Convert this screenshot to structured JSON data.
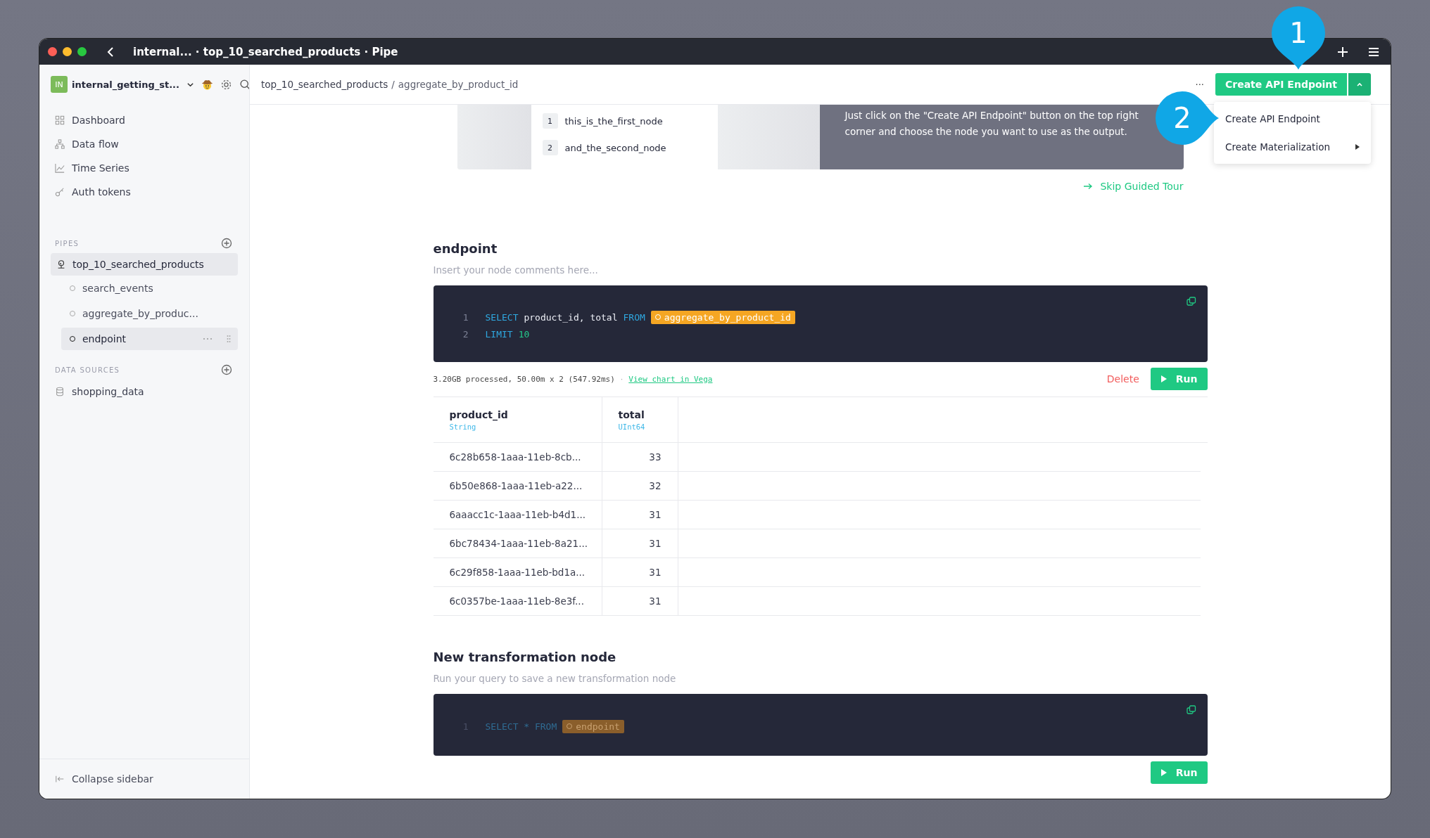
{
  "window": {
    "title": "internal... · top_10_searched_products · Pipe"
  },
  "workspace": {
    "initials": "IN",
    "name": "internal_getting_st..."
  },
  "nav": [
    {
      "label": "Dashboard"
    },
    {
      "label": "Data flow"
    },
    {
      "label": "Time Series"
    },
    {
      "label": "Auth tokens"
    }
  ],
  "pipes": {
    "heading": "PIPES",
    "items": [
      {
        "label": "top_10_searched_products",
        "selected": true,
        "children": [
          {
            "label": "search_events",
            "selected": false
          },
          {
            "label": "aggregate_by_produc...",
            "selected": false
          },
          {
            "label": "endpoint",
            "selected": true
          }
        ]
      }
    ]
  },
  "data_sources": {
    "heading": "DATA SOURCES",
    "items": [
      {
        "label": "shopping_data"
      }
    ]
  },
  "collapse_sidebar": "Collapse sidebar",
  "breadcrumb": {
    "parent": "top_10_searched_products",
    "separator": "/",
    "current": "aggregate_by_product_id"
  },
  "more": "···",
  "create_button": "Create API Endpoint",
  "menu": [
    {
      "label": "Create API Endpoint",
      "submenu": false
    },
    {
      "label": "Create Materialization",
      "submenu": true
    }
  ],
  "callouts": [
    "1",
    "2"
  ],
  "tour": {
    "nodes": [
      {
        "number": "1",
        "name": "this_is_the_first_node"
      },
      {
        "number": "2",
        "name": "and_the_second_node"
      }
    ],
    "text": "Just click on the \"Create API Endpoint\" button on the top right corner and choose the node you want to use as the output.",
    "skip": "Skip Guided Tour"
  },
  "nodes": [
    {
      "title": "endpoint",
      "subtitle": "Insert your node comments here...",
      "dimmed": false,
      "code": [
        {
          "number": "1",
          "tokens": [
            {
              "kind": "keyword",
              "text": "SELECT"
            },
            {
              "kind": "plain",
              "text": "product_id, total"
            },
            {
              "kind": "keyword",
              "text": "FROM"
            },
            {
              "kind": "ref",
              "text": "aggregate_by_product_id"
            }
          ]
        },
        {
          "number": "2",
          "tokens": [
            {
              "kind": "keyword",
              "text": "LIMIT"
            },
            {
              "kind": "number",
              "text": "10"
            }
          ]
        }
      ],
      "stats": "3.20GB processed, 50.00m x 2 (547.92ms)",
      "separator": "·",
      "link": "View chart in Vega",
      "delete": "Delete",
      "run": "Run",
      "table": {
        "columns": [
          {
            "name": "product_id",
            "type": "String"
          },
          {
            "name": "total",
            "type": "UInt64"
          }
        ],
        "rows": [
          [
            "6c28b658-1aaa-11eb-8cb...",
            "33"
          ],
          [
            "6b50e868-1aaa-11eb-a22...",
            "32"
          ],
          [
            "6aaacc1c-1aaa-11eb-b4d1...",
            "31"
          ],
          [
            "6bc78434-1aaa-11eb-8a21...",
            "31"
          ],
          [
            "6c29f858-1aaa-11eb-bd1a...",
            "31"
          ],
          [
            "6c0357be-1aaa-11eb-8e3f...",
            "31"
          ]
        ]
      }
    },
    {
      "title": "New transformation node",
      "subtitle": "Run your query to save a new transformation node",
      "dimmed": true,
      "code": [
        {
          "number": "1",
          "tokens": [
            {
              "kind": "keyword",
              "text": "SELECT * FROM"
            },
            {
              "kind": "ref",
              "text": "endpoint"
            }
          ]
        }
      ],
      "run": "Run"
    }
  ]
}
